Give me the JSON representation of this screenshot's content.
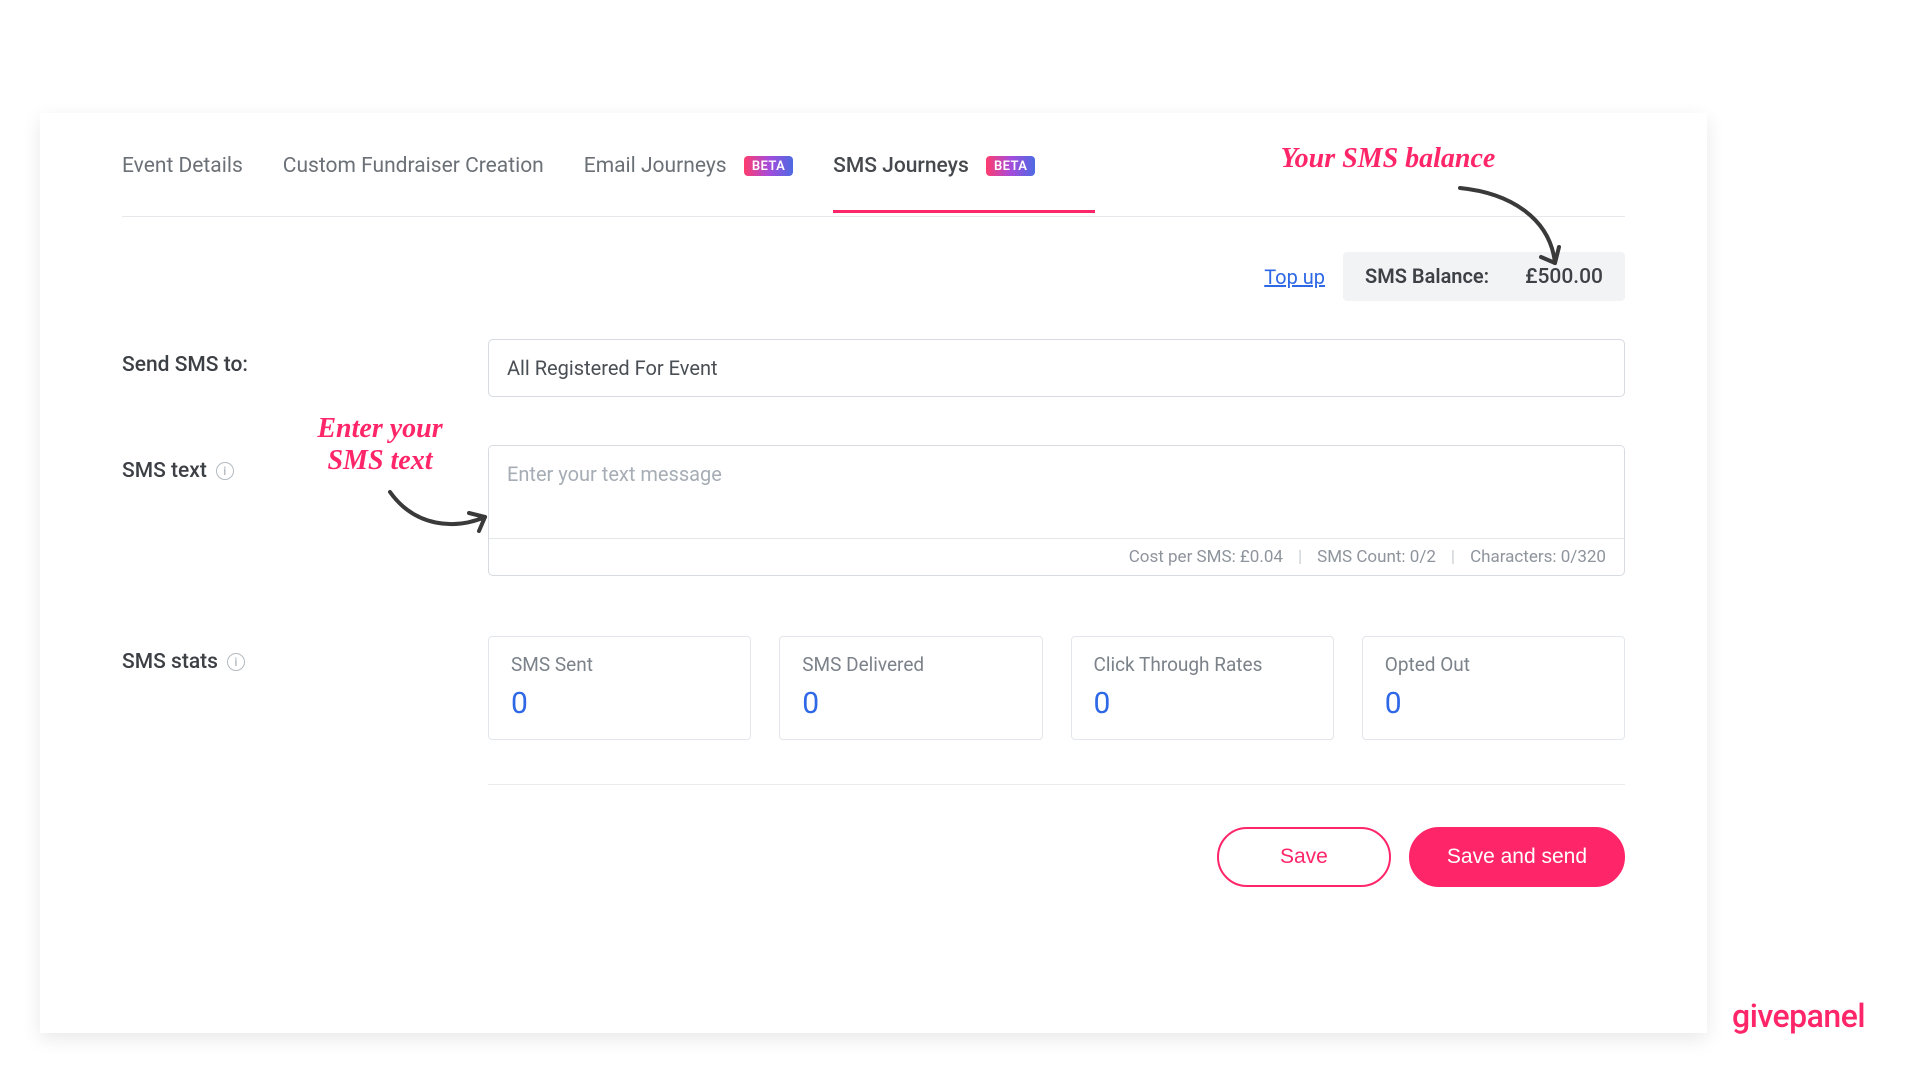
{
  "tabs": {
    "event_details": "Event Details",
    "custom_creation": "Custom Fundraiser Creation",
    "email_journeys": "Email Journeys",
    "sms_journeys": "SMS Journeys",
    "beta_badge": "BETA"
  },
  "balance": {
    "topup": "Top up",
    "label": "SMS Balance:",
    "value": "£500.00"
  },
  "form": {
    "send_to_label": "Send SMS to:",
    "send_to_value": "All Registered For Event",
    "sms_text_label": "SMS text",
    "sms_text_placeholder": "Enter your text message",
    "sms_text_value": "",
    "meta_cost": "Cost per SMS: £0.04",
    "meta_count": "SMS Count: 0/2",
    "meta_chars": "Characters:  0/320"
  },
  "stats": {
    "section_label": "SMS stats",
    "cards": [
      {
        "label": "SMS Sent",
        "value": "0"
      },
      {
        "label": "SMS Delivered",
        "value": "0"
      },
      {
        "label": "Click Through Rates",
        "value": "0"
      },
      {
        "label": "Opted Out",
        "value": "0"
      }
    ]
  },
  "footer": {
    "save": "Save",
    "save_send": "Save and send"
  },
  "annotations": {
    "balance": "Your SMS balance",
    "sms_text_line1": "Enter your",
    "sms_text_line2": "SMS text"
  },
  "brand": "givepanel"
}
